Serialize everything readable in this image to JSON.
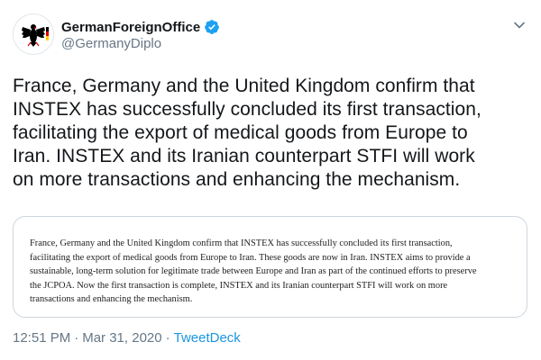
{
  "author": {
    "display_name": "GermanForeignOffice",
    "handle": "@GermanyDiplo",
    "verified": true,
    "avatar_icon": "federal-eagle-icon",
    "flag_colors": [
      "#000000",
      "#dd0000",
      "#ffce00"
    ]
  },
  "tweet": {
    "text_lines": [
      "France, Germany and the United Kingdom confirm that",
      "INSTEX has successfully concluded its first transaction,",
      "facilitating the export of medical goods from Europe to",
      "Iran. INSTEX and its Iranian counterpart STFI will work",
      "on more transactions and enhancing the mechanism."
    ]
  },
  "card": {
    "text_lines": [
      "France, Germany and the United Kingdom confirm that INSTEX has successfully concluded its first transaction,",
      "facilitating the export of medical goods from Europe to Iran. These goods are now in Iran. INSTEX aims to provide a",
      "sustainable, long-term solution for legitimate trade between Europe and Iran as part of the continued efforts to preserve",
      "the JCPOA. Now the first transaction is complete, INSTEX and its Iranian counterpart STFI will work on more",
      "transactions and enhancing the mechanism."
    ]
  },
  "meta": {
    "time": "12:51 PM",
    "separator": "·",
    "date": "Mar 31, 2020",
    "source": "TweetDeck"
  },
  "colors": {
    "verified_blue": "#1da1f2",
    "secondary_text": "#657786",
    "link_blue": "#1b95e0",
    "border": "#ccd6dd"
  },
  "icons": {
    "verified": "verified-badge-icon",
    "caret": "chevron-down-icon"
  }
}
